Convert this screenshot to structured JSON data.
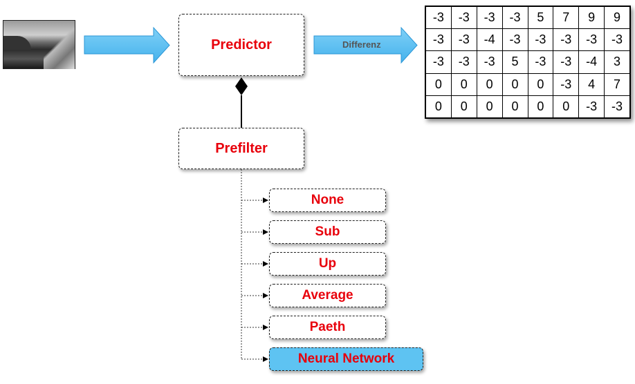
{
  "predictor": {
    "label": "Predictor"
  },
  "arrow_label": "Differenz",
  "prefilter": {
    "label": "Prefilter"
  },
  "filters": [
    {
      "label": "None",
      "highlighted": false
    },
    {
      "label": "Sub",
      "highlighted": false
    },
    {
      "label": "Up",
      "highlighted": false
    },
    {
      "label": "Average",
      "highlighted": false
    },
    {
      "label": "Paeth",
      "highlighted": false
    },
    {
      "label": "Neural Network",
      "highlighted": true
    }
  ],
  "difference_table": [
    [
      "-3",
      "-3",
      "-3",
      "-3",
      "5",
      "7",
      "9",
      "9"
    ],
    [
      "-3",
      "-3",
      "-4",
      "-3",
      "-3",
      "-3",
      "-3",
      "-3"
    ],
    [
      "-3",
      "-3",
      "-3",
      "5",
      "-3",
      "-3",
      "-4",
      "3"
    ],
    [
      "0",
      "0",
      "0",
      "0",
      "0",
      "-3",
      "4",
      "7"
    ],
    [
      "0",
      "0",
      "0",
      "0",
      "0",
      "0",
      "-3",
      "-3"
    ]
  ],
  "colors": {
    "label_red": "#e8000b",
    "arrow_blue": "#5ec3f2",
    "highlight_blue": "#5ec3f2"
  }
}
